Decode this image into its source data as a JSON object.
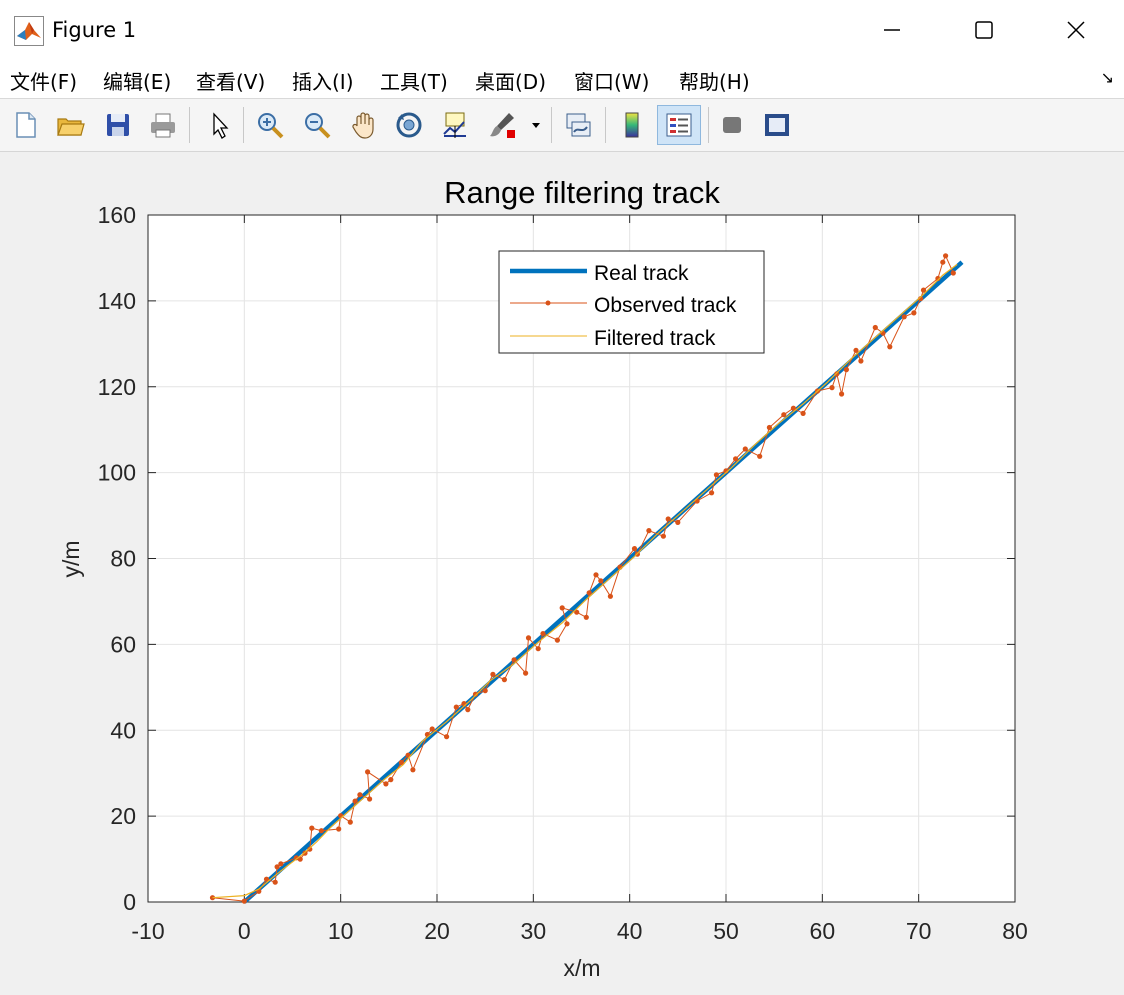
{
  "window": {
    "title": "Figure 1",
    "buttons": {
      "minimize": "minimize-icon",
      "maximize": "maximize-icon",
      "close": "close-icon"
    }
  },
  "menu": {
    "items": [
      {
        "label": "文件(F)",
        "mnemonic": "F"
      },
      {
        "label": "编辑(E)",
        "mnemonic": "E"
      },
      {
        "label": "查看(V)",
        "mnemonic": "V"
      },
      {
        "label": "插入(I)",
        "mnemonic": "I"
      },
      {
        "label": "工具(T)",
        "mnemonic": "T"
      },
      {
        "label": "桌面(D)",
        "mnemonic": "D"
      },
      {
        "label": "窗口(W)",
        "mnemonic": "W"
      },
      {
        "label": "帮助(H)",
        "mnemonic": "H"
      }
    ]
  },
  "toolbar": {
    "tools": [
      "new-figure-icon",
      "open-file-icon",
      "save-icon",
      "print-icon",
      "select-arrow-icon",
      "zoom-in-icon",
      "zoom-out-icon",
      "pan-hand-icon",
      "rotate-3d-icon",
      "data-cursor-icon",
      "brush-icon",
      "link-plot-icon",
      "colorbar-icon",
      "legend-icon",
      "hide-plot-tools-icon",
      "show-plot-tools-icon"
    ]
  },
  "colors": {
    "real": "#0072BD",
    "observed": "#D95319",
    "filtered": "#EDB120",
    "grid": "#e4e4e4"
  },
  "chart_data": {
    "type": "line",
    "title": "Range filtering track",
    "xlabel": "x/m",
    "ylabel": "y/m",
    "xlim": [
      -10,
      80
    ],
    "ylim": [
      0,
      160
    ],
    "xticks": [
      -10,
      0,
      10,
      20,
      30,
      40,
      50,
      60,
      70,
      80
    ],
    "yticks": [
      0,
      20,
      40,
      60,
      80,
      100,
      120,
      140,
      160
    ],
    "grid": true,
    "legend_position": "top-center",
    "series": [
      {
        "name": "Real track",
        "style": "thick-line",
        "points": [
          [
            0,
            0
          ],
          [
            74.5,
            149
          ]
        ]
      },
      {
        "name": "Observed track",
        "style": "line-with-dots",
        "points": [
          [
            -3.3,
            1.0
          ],
          [
            0,
            0.2
          ],
          [
            1.5,
            2.5
          ],
          [
            2.3,
            5.3
          ],
          [
            3.2,
            4.6
          ],
          [
            3.4,
            8.2
          ],
          [
            3.8,
            8.9
          ],
          [
            5.4,
            10.3
          ],
          [
            5.8,
            10.0
          ],
          [
            6.3,
            11.4
          ],
          [
            6.8,
            12.3
          ],
          [
            7.0,
            17.2
          ],
          [
            8.0,
            16.6
          ],
          [
            9.8,
            17.0
          ],
          [
            10.0,
            20.1
          ],
          [
            11.0,
            18.6
          ],
          [
            11.5,
            23.5
          ],
          [
            12.0,
            25.0
          ],
          [
            13.0,
            24.0
          ],
          [
            12.8,
            30.3
          ],
          [
            14.7,
            27.5
          ],
          [
            15.2,
            28.5
          ],
          [
            16.3,
            32.5
          ],
          [
            17.0,
            34.2
          ],
          [
            17.5,
            30.8
          ],
          [
            19.0,
            39.0
          ],
          [
            19.5,
            40.3
          ],
          [
            21.0,
            38.5
          ],
          [
            22.0,
            45.4
          ],
          [
            22.8,
            46.2
          ],
          [
            23.2,
            44.8
          ],
          [
            24.0,
            48.4
          ],
          [
            25.0,
            49.2
          ],
          [
            25.8,
            53.0
          ],
          [
            27.0,
            51.8
          ],
          [
            28.0,
            56.4
          ],
          [
            29.2,
            53.3
          ],
          [
            29.5,
            61.5
          ],
          [
            30.5,
            59.0
          ],
          [
            31.0,
            62.5
          ],
          [
            32.5,
            61.0
          ],
          [
            33.5,
            64.8
          ],
          [
            33.0,
            68.5
          ],
          [
            34.5,
            67.5
          ],
          [
            35.5,
            66.3
          ],
          [
            35.8,
            72.0
          ],
          [
            36.5,
            76.2
          ],
          [
            37.0,
            74.8
          ],
          [
            38.0,
            71.2
          ],
          [
            39.0,
            78.0
          ],
          [
            40.5,
            82.3
          ],
          [
            40.8,
            81.0
          ],
          [
            42.0,
            86.5
          ],
          [
            43.5,
            85.2
          ],
          [
            44.0,
            89.2
          ],
          [
            45.0,
            88.4
          ],
          [
            47.0,
            93.4
          ],
          [
            48.5,
            95.3
          ],
          [
            49.0,
            99.5
          ],
          [
            50.0,
            100.4
          ],
          [
            51.0,
            103.2
          ],
          [
            52.0,
            105.5
          ],
          [
            53.5,
            103.8
          ],
          [
            54.5,
            110.5
          ],
          [
            56.0,
            113.5
          ],
          [
            57.0,
            115.0
          ],
          [
            58.0,
            113.8
          ],
          [
            59.5,
            119.0
          ],
          [
            61.0,
            119.8
          ],
          [
            61.5,
            123.0
          ],
          [
            62.0,
            118.3
          ],
          [
            62.5,
            124.0
          ],
          [
            63.5,
            128.5
          ],
          [
            64.0,
            126.0
          ],
          [
            65.5,
            133.8
          ],
          [
            66.3,
            132.5
          ],
          [
            67.0,
            129.3
          ],
          [
            68.5,
            136.3
          ],
          [
            69.5,
            137.2
          ],
          [
            70.2,
            140.5
          ],
          [
            70.5,
            142.5
          ],
          [
            72.0,
            145.2
          ],
          [
            72.5,
            149.0
          ],
          [
            72.8,
            150.5
          ],
          [
            73.6,
            146.5
          ]
        ]
      },
      {
        "name": "Filtered track",
        "style": "thin-line",
        "points": [
          [
            -3.3,
            1.0
          ],
          [
            0,
            1.5
          ],
          [
            1.5,
            3.0
          ],
          [
            3.0,
            5.8
          ],
          [
            4.5,
            8.5
          ],
          [
            6.0,
            11.0
          ],
          [
            7.5,
            14.0
          ],
          [
            9.0,
            17.5
          ],
          [
            10.5,
            20.5
          ],
          [
            12.5,
            24.5
          ],
          [
            14.5,
            28.5
          ],
          [
            16.5,
            32.0
          ],
          [
            18.5,
            37.5
          ],
          [
            21.0,
            42.0
          ],
          [
            23.5,
            47.0
          ],
          [
            25.5,
            51.5
          ],
          [
            28.0,
            55.5
          ],
          [
            30.5,
            60.5
          ],
          [
            33.0,
            65.0
          ],
          [
            35.5,
            70.5
          ],
          [
            38.0,
            75.5
          ],
          [
            40.5,
            80.5
          ],
          [
            43.0,
            86.0
          ],
          [
            45.5,
            91.0
          ],
          [
            48.0,
            96.0
          ],
          [
            50.5,
            101.0
          ],
          [
            53.0,
            106.5
          ],
          [
            55.5,
            111.5
          ],
          [
            58.0,
            116.0
          ],
          [
            60.5,
            121.0
          ],
          [
            63.0,
            126.5
          ],
          [
            65.5,
            131.5
          ],
          [
            68.0,
            136.5
          ],
          [
            70.5,
            141.5
          ],
          [
            72.5,
            146.0
          ],
          [
            74.0,
            148.5
          ]
        ]
      }
    ]
  }
}
